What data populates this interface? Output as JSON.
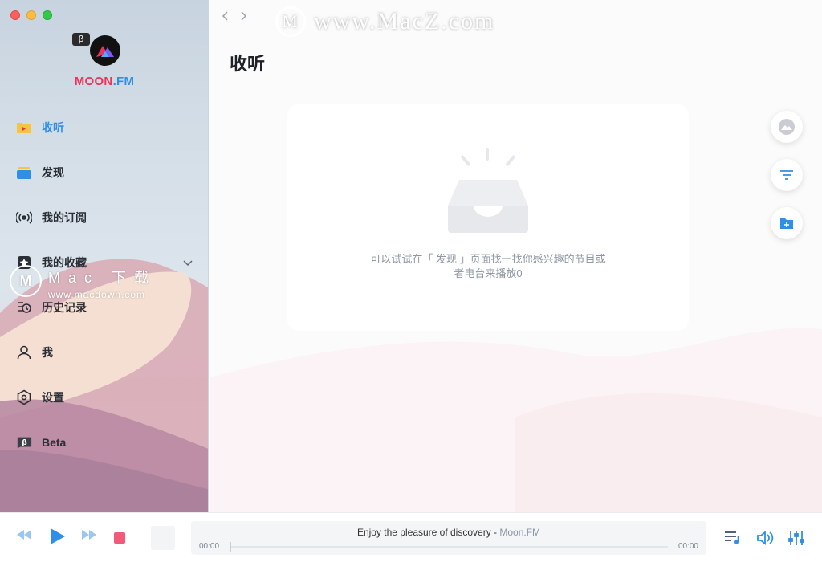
{
  "app": {
    "logo_badge": "β",
    "logo_moon": "MOON",
    "logo_fm": ".FM"
  },
  "sidebar": {
    "items": [
      {
        "label": "收听",
        "icon": "folder-icon",
        "active": true
      },
      {
        "label": "发现",
        "icon": "discover-stack-icon"
      },
      {
        "label": "我的订阅",
        "icon": "broadcast-icon"
      },
      {
        "label": "我的收藏",
        "icon": "star-icon",
        "expandable": true
      },
      {
        "label": "历史记录",
        "icon": "history-icon"
      },
      {
        "label": "我",
        "icon": "user-icon"
      },
      {
        "label": "设置",
        "icon": "settings-hex-icon"
      },
      {
        "label": "Beta",
        "icon": "beta-icon"
      }
    ]
  },
  "watermark": {
    "top": "www.MacZ.com",
    "side_main": "Mac 下载",
    "side_sub": "www.macdown.com",
    "letter": "M"
  },
  "main": {
    "title": "收听",
    "empty_line1": "可以试试在「 发现 」页面找一找你感兴趣的节目或",
    "empty_line2": "者电台来播放0"
  },
  "player": {
    "now_playing": "Enjoy the pleasure of discovery - ",
    "now_playing_brand": "Moon.FM",
    "time_current": "00:00",
    "time_total": "00:00",
    "progress": 0
  },
  "colors": {
    "accent_blue": "#2f8fe8",
    "brand_red": "#e8345a",
    "play_blue": "#2f8fe8",
    "stop_pink": "#f25a7a"
  }
}
